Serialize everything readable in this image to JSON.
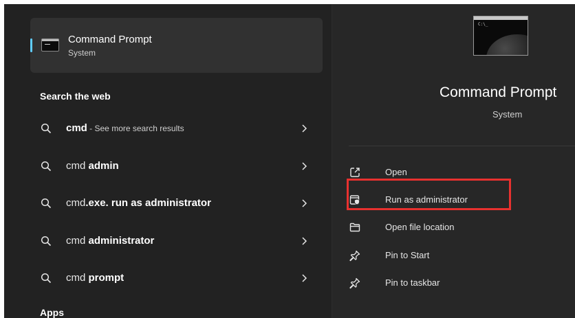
{
  "best_match": {
    "title": "Command Prompt",
    "subtitle": "System"
  },
  "sections": {
    "web": "Search the web",
    "apps": "Apps"
  },
  "web_results": [
    {
      "plain": "",
      "bold": "cmd",
      "hint": " - See more search results"
    },
    {
      "plain": "cmd ",
      "bold": "admin",
      "hint": ""
    },
    {
      "plain": "cmd",
      "bold": ".exe. run as administrator",
      "hint": ""
    },
    {
      "plain": "cmd ",
      "bold": "administrator",
      "hint": ""
    },
    {
      "plain": "cmd ",
      "bold": "prompt",
      "hint": ""
    }
  ],
  "details": {
    "title": "Command Prompt",
    "subtitle": "System"
  },
  "actions": [
    {
      "label": "Open",
      "icon": "open-external-icon"
    },
    {
      "label": "Run as administrator",
      "icon": "shield-admin-icon"
    },
    {
      "label": "Open file location",
      "icon": "folder-icon"
    },
    {
      "label": "Pin to Start",
      "icon": "pin-icon"
    },
    {
      "label": "Pin to taskbar",
      "icon": "pin-icon"
    }
  ],
  "colors": {
    "panel": "#222222",
    "accent": "#60cdff",
    "highlight": "#e8312f"
  }
}
